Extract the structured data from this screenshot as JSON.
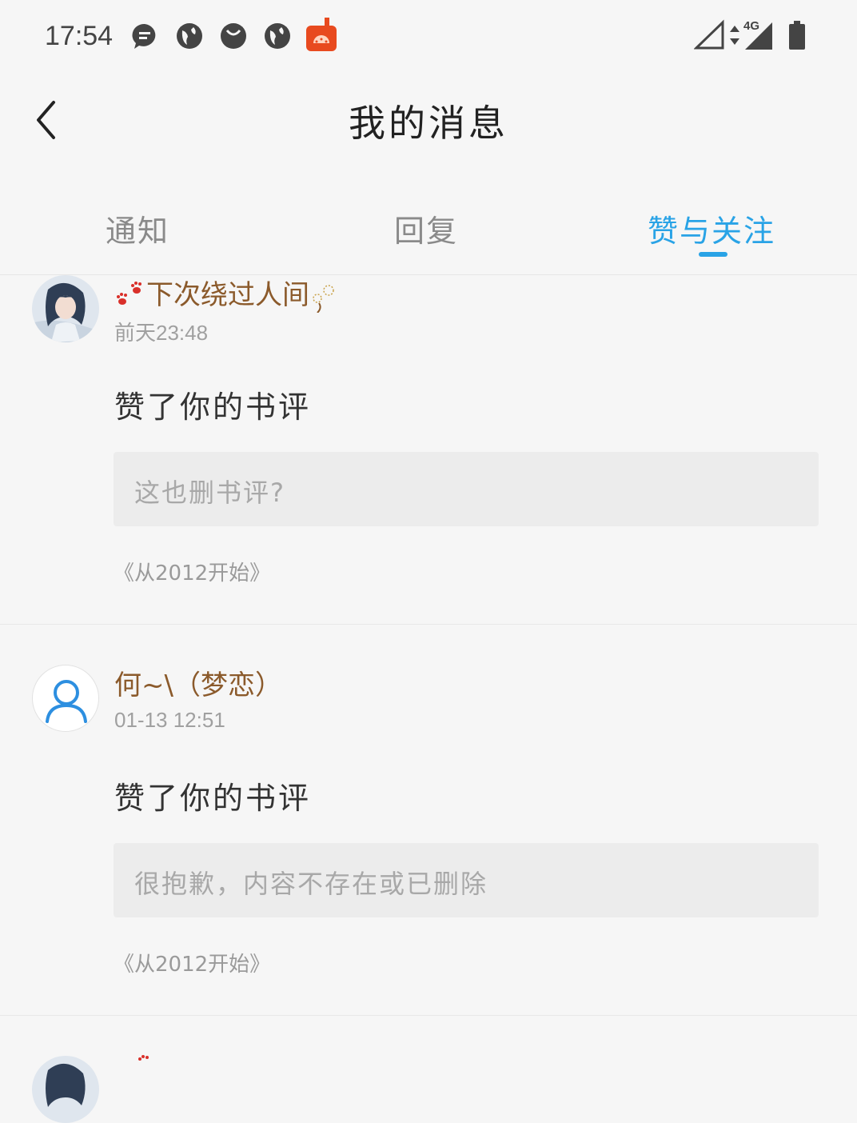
{
  "status_bar": {
    "time": "17:54",
    "network": "4G",
    "icons": [
      "message-bubble-icon",
      "globe-icon",
      "moon-icon",
      "globe-icon",
      "tomato-app-icon"
    ]
  },
  "header": {
    "title": "我的消息",
    "back_icon": "chevron-left-icon"
  },
  "tabs": [
    {
      "label": "通知",
      "active": false
    },
    {
      "label": "回复",
      "active": false
    },
    {
      "label": "赞与关注",
      "active": true
    }
  ],
  "items": [
    {
      "user": "下次绕过人间",
      "time": "前天23:48",
      "action": "赞了你的书评",
      "quote": "这也删书评?",
      "book": "《从2012开始》",
      "avatar": "anime-avatar"
    },
    {
      "user": "何~\\（梦恋）",
      "time": "01-13 12:51",
      "action": "赞了你的书评",
      "quote": "很抱歉，内容不存在或已删除",
      "book": "《从2012开始》",
      "avatar": "default-user-icon"
    }
  ],
  "colors": {
    "accent": "#29a3e6",
    "username": "#8b5a2b",
    "background": "#f6f6f6"
  }
}
